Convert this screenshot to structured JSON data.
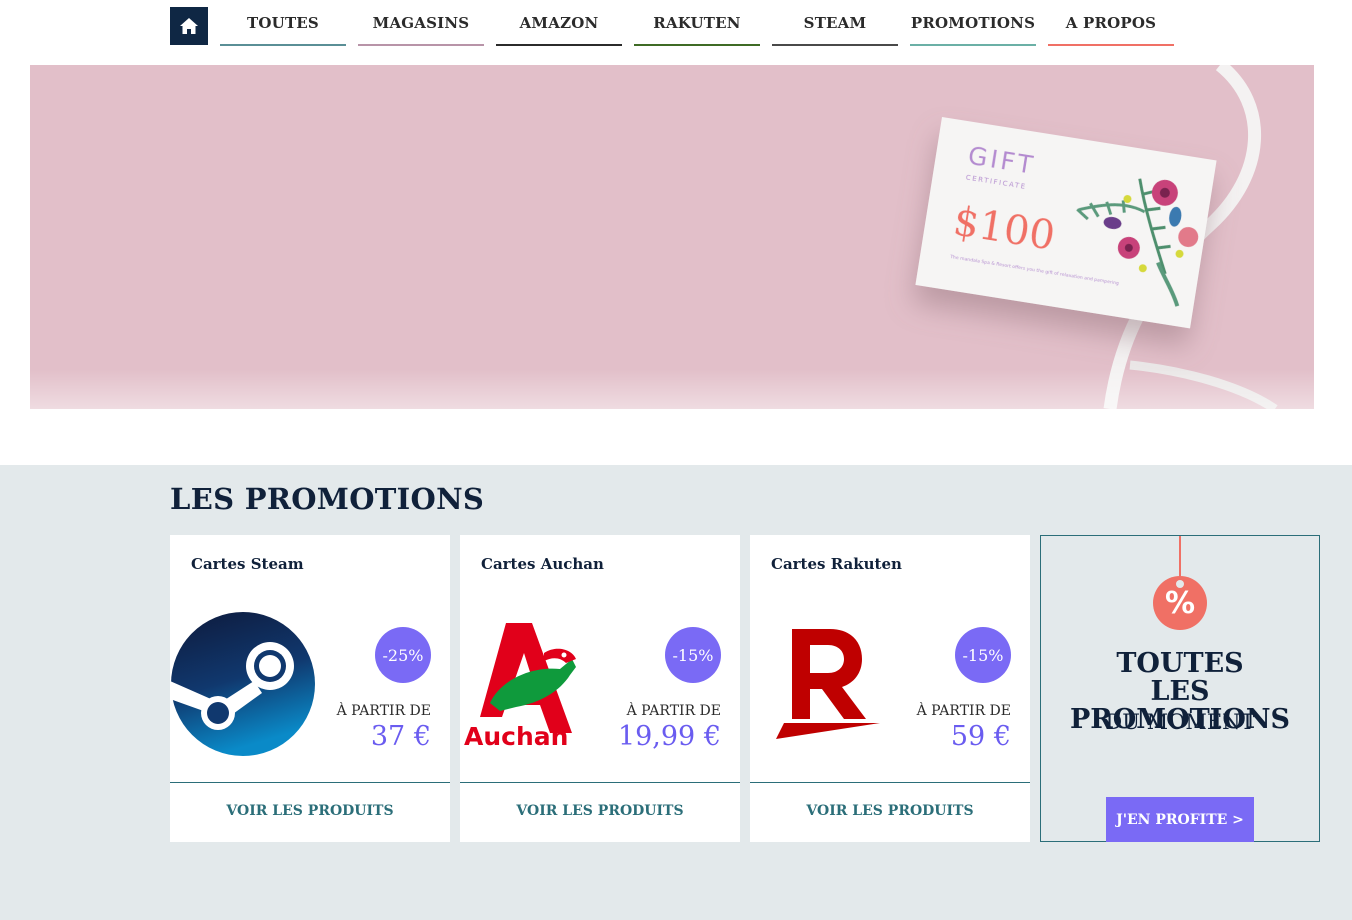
{
  "nav": {
    "home_icon": "home-icon",
    "items": [
      {
        "label": "TOUTES",
        "color": "#5a8f96"
      },
      {
        "label": "MAGASINS",
        "color": "#b894a8"
      },
      {
        "label": "AMAZON",
        "color": "#2b2b2b"
      },
      {
        "label": "RAKUTEN",
        "color": "#3f6b25"
      },
      {
        "label": "STEAM",
        "color": "#4a4a4a"
      },
      {
        "label": "PROMOTIONS",
        "color": "#6bb0a6"
      },
      {
        "label": "A PROPOS",
        "color": "#f07065"
      }
    ]
  },
  "hero": {
    "gift_title": "GIFT",
    "gift_subtitle": "CERTIFICATE",
    "gift_amount": "$100",
    "gift_fineprint": "The mandala Spa & Resort offers you the gift of relaxation and pampering"
  },
  "promotions": {
    "title": "LES PROMOTIONS",
    "cards": [
      {
        "title": "Cartes Steam",
        "logo": "steam-logo",
        "badge": "-25%",
        "from_label": "À PARTIR DE",
        "price": "37 €",
        "link": "VOIR LES PRODUITS"
      },
      {
        "title": "Cartes Auchan",
        "logo": "auchan-logo",
        "logo_text": "Auchan",
        "badge": "-15%",
        "from_label": "À PARTIR DE",
        "price": "19,99 €",
        "link": "VOIR LES PRODUITS"
      },
      {
        "title": "Cartes Rakuten",
        "logo": "rakuten-logo",
        "badge": "-15%",
        "from_label": "À PARTIR DE",
        "price": "59 €",
        "link": "VOIR LES PRODUITS"
      }
    ],
    "all_promos": {
      "icon": "percent-icon",
      "icon_text": "%",
      "title_line1": "TOUTES",
      "title_line2": "LES PROMOTIONS",
      "subtitle": "DU MOMENT",
      "button": "J'EN PROFITE >"
    }
  },
  "colors": {
    "navy": "#0f2744",
    "accent_purple": "#7a6af5",
    "hero_pink": "#e2bfc9",
    "section_bg": "#e3e9eb",
    "teal": "#2b6e79",
    "coral": "#f07065"
  }
}
